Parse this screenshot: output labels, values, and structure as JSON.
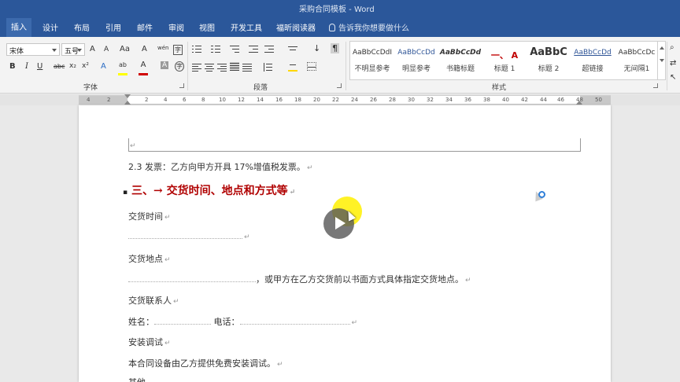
{
  "window": {
    "title": "采购合同模板 - Word"
  },
  "tabs": [
    {
      "label": "插入",
      "active": true
    },
    {
      "label": "设计"
    },
    {
      "label": "布局"
    },
    {
      "label": "引用"
    },
    {
      "label": "邮件"
    },
    {
      "label": "审阅"
    },
    {
      "label": "视图"
    },
    {
      "label": "开发工具"
    },
    {
      "label": "福昕阅读器"
    }
  ],
  "tell_me": {
    "placeholder": "告诉我你想要做什么"
  },
  "ribbon": {
    "font": {
      "family": "宋体",
      "size": "五号",
      "grow": "A",
      "shrink": "A",
      "case": "Aa",
      "clear_format": "A",
      "phonetic": "wén",
      "enclose": "字",
      "bold": "B",
      "italic": "I",
      "underline": "U",
      "strikethrough": "abc",
      "subscript": "x₂",
      "superscript": "x²",
      "text_effect": "A",
      "highlight": "ab",
      "font_color": "A",
      "char_shading": "A",
      "char_border": "字",
      "group_label": "字体"
    },
    "paragraph": {
      "group_label": "段落",
      "sort": "↓",
      "show_marks": "¶"
    },
    "styles": {
      "group_label": "样式",
      "items": [
        {
          "preview": "AaBbCcDdI",
          "name": "不明显参考"
        },
        {
          "preview": "AaBbCcDd",
          "name": "明显参考"
        },
        {
          "preview": "AaBbCcDd",
          "name": "书籍标题"
        },
        {
          "preview": "一、 A",
          "name": "标题 1"
        },
        {
          "preview": "AaBbC",
          "name": "标题 2"
        },
        {
          "preview": "AaBbCcDd",
          "name": "超链接"
        },
        {
          "preview": "AaBbCcDc",
          "name": "无间隔1"
        }
      ]
    }
  },
  "ruler": {
    "ticks": [
      "4",
      "2",
      "2",
      "4",
      "6",
      "8",
      "10",
      "12",
      "14",
      "16",
      "18",
      "20",
      "22",
      "24",
      "26",
      "28",
      "30",
      "32",
      "34",
      "36",
      "38",
      "40",
      "42",
      "44",
      "46",
      "48",
      "50"
    ]
  },
  "document": {
    "para_mark": "↵",
    "invoice_line": "2.3 发票：乙方向甲方开具 17%增值税发票。",
    "heading_bullet": "▪",
    "heading": "三、→ 交货时间、地点和方式等",
    "delivery_time_label": "交货时间",
    "delivery_place_label": "交货地点",
    "delivery_place_tail": "，或甲方在乙方交货前以书面方式具体指定交货地点。",
    "contact_label": "交货联系人",
    "name_label": "姓名：",
    "phone_label": "电话：",
    "install_label": "安装调试",
    "install_text": "本合同设备由乙方提供免费安装调试。",
    "other_label": "其他"
  }
}
